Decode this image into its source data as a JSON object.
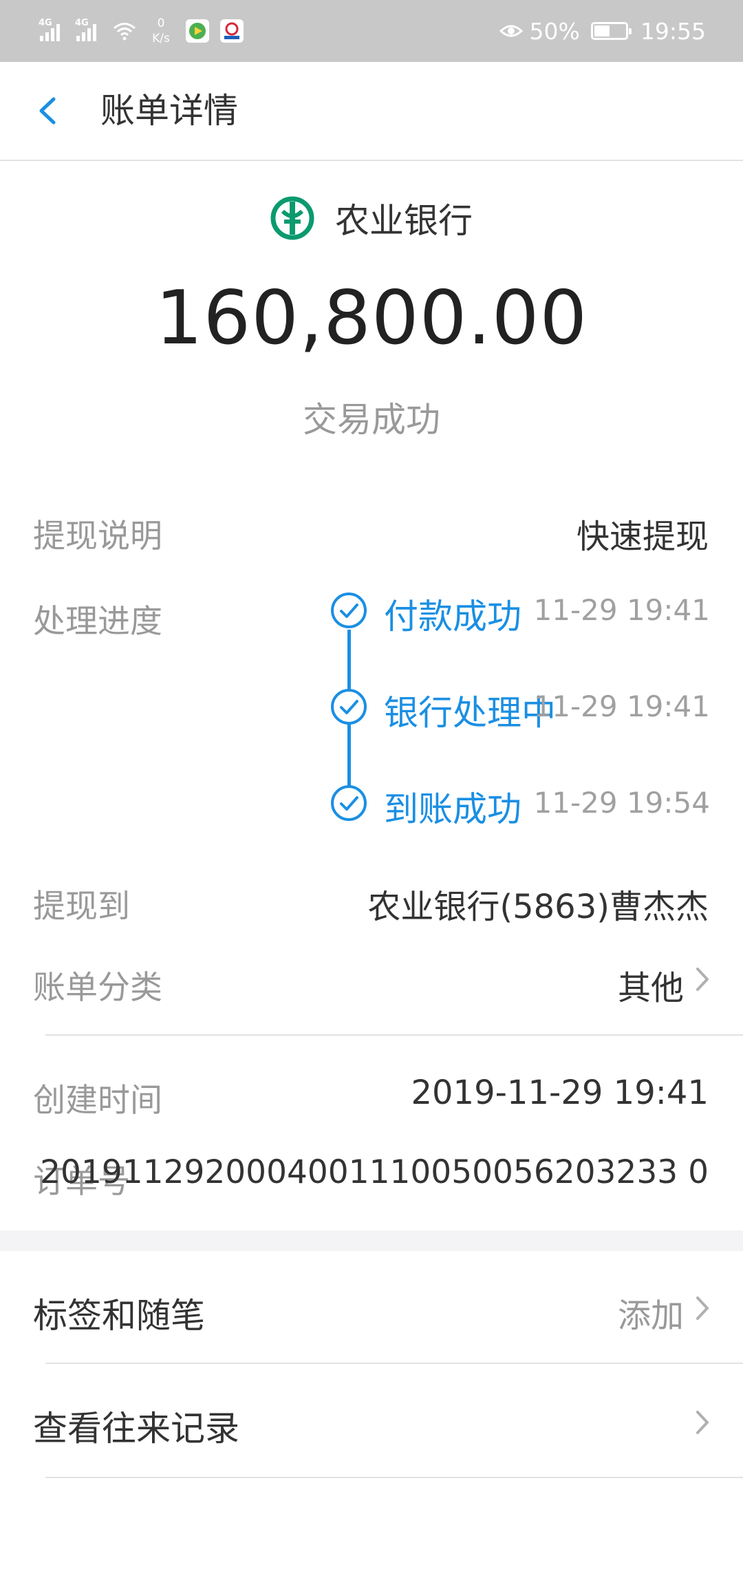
{
  "status_bar": {
    "net_type_1": "4G",
    "net_type_2": "4G",
    "speed_value": "0",
    "speed_unit": "K/s",
    "battery_pct": "50%",
    "battery_level": 0.5,
    "time": "19:55",
    "icons": [
      "signal-icon",
      "signal-icon",
      "wifi-icon",
      "video-app-icon",
      "bank-app-icon",
      "eye-icon",
      "battery-icon"
    ]
  },
  "header": {
    "title": "账单详情",
    "back_icon": "chevron-left-icon"
  },
  "summary": {
    "bank_name": "农业银行",
    "amount": "160,800.00",
    "status": "交易成功",
    "logo_color": "#0a9a6e"
  },
  "details": {
    "withdraw_desc_label": "提现说明",
    "withdraw_desc_value": "快速提现",
    "progress_label": "处理进度",
    "progress": [
      {
        "step": "付款成功",
        "time": "11-29 19:41"
      },
      {
        "step": "银行处理中",
        "time": "11-29 19:41"
      },
      {
        "step": "到账成功",
        "time": "11-29 19:54"
      }
    ],
    "withdraw_to_label": "提现到",
    "withdraw_to_value": "农业银行(5863)曹杰杰",
    "category_label": "账单分类",
    "category_value": "其他",
    "created_label": "创建时间",
    "created_value": "2019-11-29 19:41",
    "order_label": "订单号",
    "order_value": "2019112920004001110050056203233 0"
  },
  "actions": {
    "tags_label": "标签和随笔",
    "tags_action": "添加",
    "history_label": "查看往来记录"
  },
  "colors": {
    "accent": "#1a8fe3",
    "status_bar": "#c8c8c8",
    "muted_text": "#999999"
  }
}
